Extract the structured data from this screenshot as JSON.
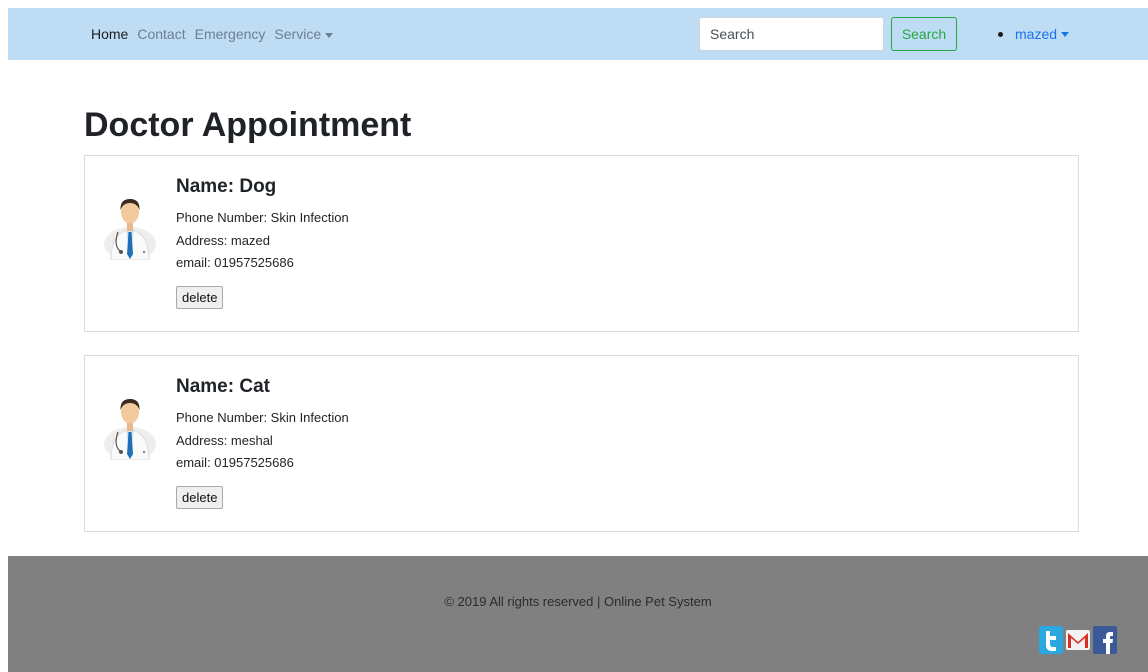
{
  "navbar": {
    "links": [
      "Home",
      "Contact",
      "Emergency",
      "Service"
    ],
    "search_placeholder": "Search",
    "search_button": "Search",
    "user": "mazed"
  },
  "page_title": "Doctor Appointment",
  "appointments": [
    {
      "name": "Name: Dog",
      "phone": "Phone Number: Skin Infection",
      "address": "Address: mazed",
      "email": "email: 01957525686",
      "delete_label": "delete"
    },
    {
      "name": "Name: Cat",
      "phone": "Phone Number: Skin Infection",
      "address": "Address: meshal",
      "email": "email: 01957525686",
      "delete_label": "delete"
    }
  ],
  "footer": {
    "copyright": "© 2019 All rights reserved | Online Pet System",
    "social_icons": [
      "twitter-icon",
      "gmail-icon",
      "facebook-icon"
    ]
  },
  "colors": {
    "navbar_bg": "#bfdcf5",
    "search_button": "#28a745",
    "user_link": "#1a73e8",
    "footer_bg": "#808080"
  }
}
